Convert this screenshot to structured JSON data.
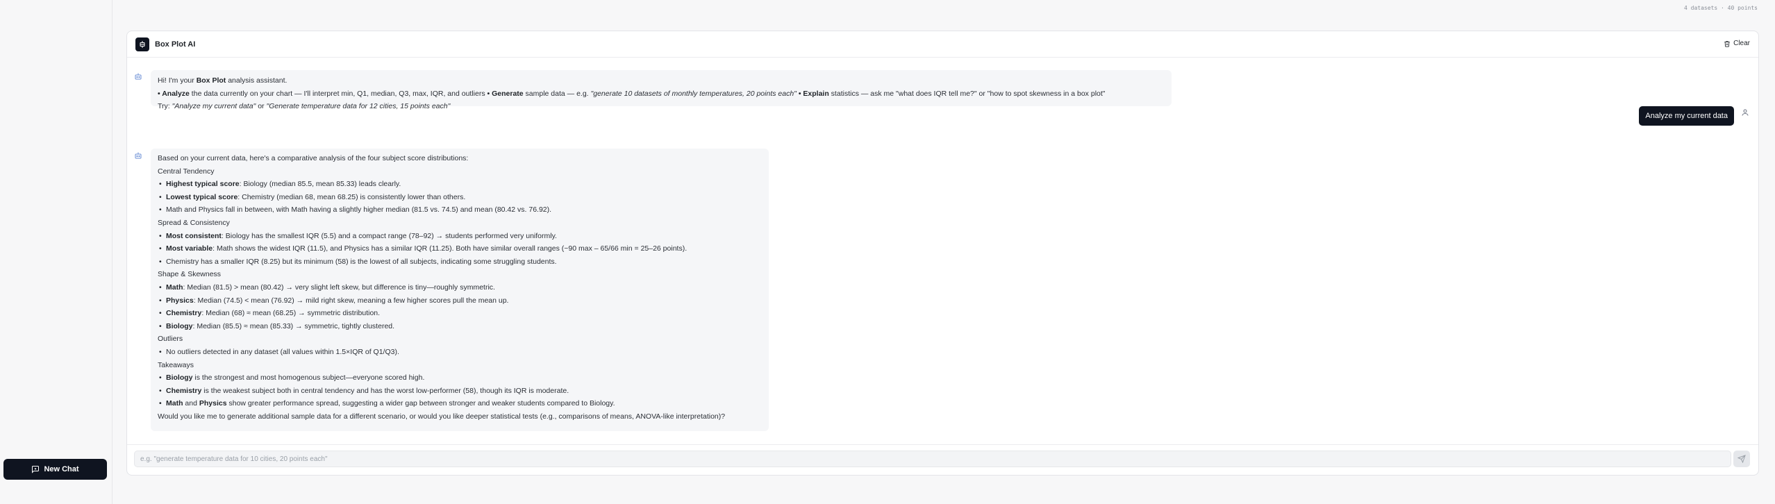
{
  "sidebar": {
    "new_chat_label": "New Chat"
  },
  "top_stat": "4 datasets · 40 points",
  "header": {
    "title": "Box Plot AI",
    "clear_label": "Clear"
  },
  "intro": {
    "greet_pre": "Hi! I'm your ",
    "greet_bold": "Box Plot",
    "greet_post": " analysis assistant.",
    "line2_b1": "• Analyze",
    "line2_t1": " the data currently on your chart — I'll interpret min, Q1, median, Q3, max, IQR, and outliers ",
    "line2_b2": "• Generate",
    "line2_t2": " sample data — e.g. ",
    "line2_i1": "\"generate 10 datasets of monthly temperatures, 20 points each\"",
    "line2_b3": " • Explain",
    "line2_t3": " statistics — ask me \"what does IQR tell me?\" or \"how to spot skewness in a box plot\"",
    "try_pre": "Try: ",
    "try_i1": "\"Analyze my current data\"",
    "try_mid": " or ",
    "try_i2": "\"Generate temperature data for 12 cities, 15 points each\""
  },
  "user_message": "Analyze my current data",
  "analysis": {
    "intro": "Based on your current data, here's a comparative analysis of the four subject score distributions:",
    "central": {
      "heading": "Central Tendency",
      "i1_b": "Highest typical score",
      "i1_t": ": Biology (median 85.5, mean 85.33) leads clearly.",
      "i2_b": "Lowest typical score",
      "i2_t": ": Chemistry (median 68, mean 68.25) is consistently lower than others.",
      "i3_t": "Math and Physics fall in between, with Math having a slightly higher median (81.5 vs. 74.5) and mean (80.42 vs. 76.92)."
    },
    "spread": {
      "heading": "Spread & Consistency",
      "i1_b": "Most consistent",
      "i1_t": ": Biology has the smallest IQR (5.5) and a compact range (78–92) → students performed very uniformly.",
      "i2_b": "Most variable",
      "i2_t": ": Math shows the widest IQR (11.5), and Physics has a similar IQR (11.25). Both have similar overall ranges (~90 max – 65/66 min = 25–26 points).",
      "i3_t": "Chemistry has a smaller IQR (8.25) but its minimum (58) is the lowest of all subjects, indicating some struggling students."
    },
    "shape": {
      "heading": "Shape & Skewness",
      "i1_b": "Math",
      "i1_t": ": Median (81.5) > mean (80.42) → very slight left skew, but difference is tiny—roughly symmetric.",
      "i2_b": "Physics",
      "i2_t": ": Median (74.5) < mean (76.92) → mild right skew, meaning a few higher scores pull the mean up.",
      "i3_b": "Chemistry",
      "i3_t": ": Median (68) ≈ mean (68.25) → symmetric distribution.",
      "i4_b": "Biology",
      "i4_t": ": Median (85.5) ≈ mean (85.33) → symmetric, tightly clustered."
    },
    "outliers": {
      "heading": "Outliers",
      "i1_t": "No outliers detected in any dataset (all values within 1.5×IQR of Q1/Q3)."
    },
    "takeaways": {
      "heading": "Takeaways",
      "i1_b": "Biology",
      "i1_t": " is the strongest and most homogenous subject—everyone scored high.",
      "i2_b": "Chemistry",
      "i2_t": " is the weakest subject both in central tendency and has the worst low-performer (58), though its IQR is moderate.",
      "i3_b1": "Math",
      "i3_t1": " and ",
      "i3_b2": "Physics",
      "i3_t2": " show greater performance spread, suggesting a wider gap between stronger and weaker students compared to Biology."
    },
    "closing": "Would you like me to generate additional sample data for a different scenario, or would you like deeper statistical tests (e.g., comparisons of means, ANOVA-like interpretation)?"
  },
  "input": {
    "placeholder": "e.g. \"generate temperature data for 10 cities, 20 points each\"",
    "value": ""
  },
  "icons": {
    "new_chat": "message-square-icon",
    "logo": "box-plot-logo-icon",
    "clear": "trash-icon",
    "bot": "bot-icon",
    "user": "user-icon",
    "send": "send-icon"
  }
}
